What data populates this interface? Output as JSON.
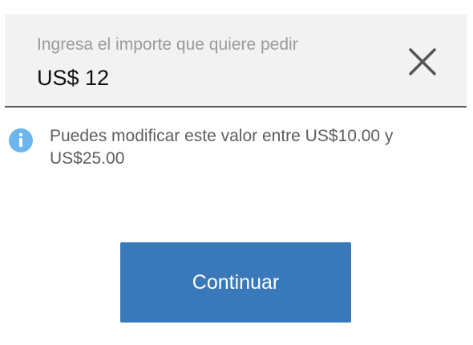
{
  "amount_field": {
    "label": "Ingresa el importe que quiere pedir",
    "value": "US$ 12",
    "clear_icon": "close-icon"
  },
  "info": {
    "icon": "info-icon",
    "icon_color": "#6bb6ef",
    "text_prefix": "Puedes modificar este valor entre",
    "min_amount": "US$10.00",
    "connector": "y",
    "max_amount": "US$25.00"
  },
  "actions": {
    "continue_label": "Continuar",
    "continue_color": "#3a79b9"
  }
}
